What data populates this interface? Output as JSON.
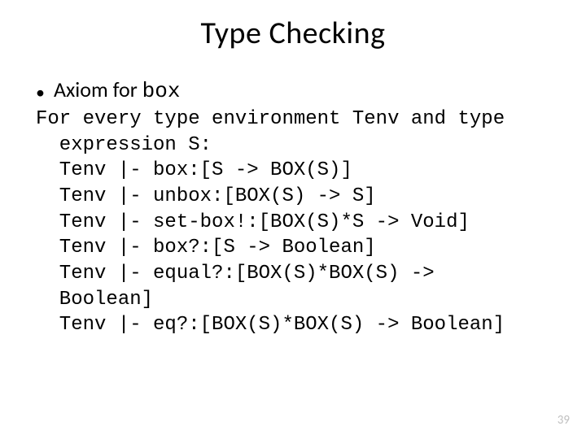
{
  "title": "Type Checking",
  "bullet": {
    "prefix": "Axiom for ",
    "code": "box"
  },
  "code": {
    "l1": "For every type environment Tenv and type",
    "l2": "  expression S:",
    "l3": "  Tenv |- box:[S -> BOX(S)]",
    "l4": "  Tenv |- unbox:[BOX(S) -> S]",
    "l5": "  Tenv |- set-box!:[BOX(S)*S -> Void]",
    "l6": "  Tenv |- box?:[S -> Boolean]",
    "l7": "  Tenv |- equal?:[BOX(S)*BOX(S) ->",
    "l8": "  Boolean]",
    "l9": "  Tenv |- eq?:[BOX(S)*BOX(S) -> Boolean]"
  },
  "pageNumber": "39"
}
